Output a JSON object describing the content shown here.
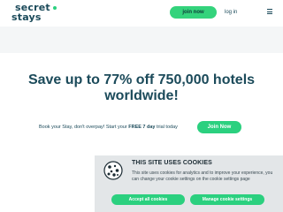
{
  "header": {
    "logo_line1": "secret",
    "logo_line2": "stays",
    "join_label": "join now",
    "login_label": "log in",
    "menu_icon": "hamburger-menu-icon"
  },
  "hero": {
    "headline": "Save up to 77% off 750,000 hotels worldwide!"
  },
  "cta": {
    "text_before": "Book your Stay, don't overpay! Start your ",
    "text_bold": "FREE 7 day",
    "text_after": " trial today",
    "button_label": "Join Now"
  },
  "cookie_banner": {
    "icon": "cookie-icon",
    "title": "THIS SITE USES COOKIES",
    "body": "This site uses cookies for analytics and to improve your experience, you can change your cookie settings on the cookie settings page",
    "accept_label": "Accept all cookies",
    "manage_label": "Manage cookie settings"
  },
  "colors": {
    "brand_green": "#2bd07f",
    "brand_navy": "#1b4a5a",
    "banner_bg": "#e3e6e8"
  }
}
